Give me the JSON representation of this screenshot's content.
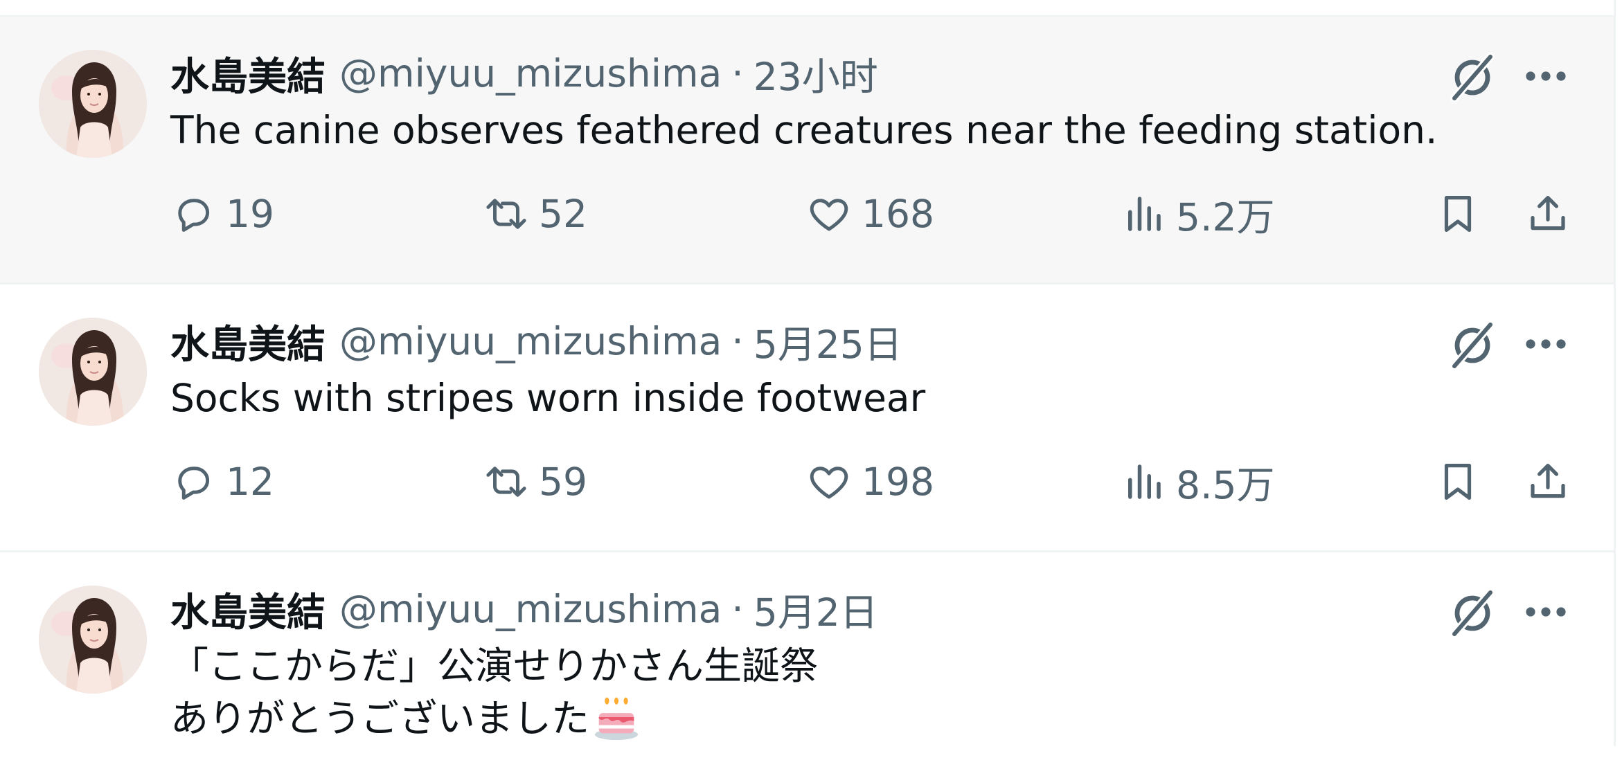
{
  "colors": {
    "text": "#0f1419",
    "muted": "#536471",
    "hover_bg": "#f7f7f7",
    "divider": "#eff3f4"
  },
  "icons": {
    "reply": "speech-bubble-icon",
    "retweet": "retweet-arrows-icon",
    "like": "heart-icon",
    "views": "bar-chart-icon",
    "bookmark": "bookmark-icon",
    "share": "upload-arrow-icon",
    "grok": "grok-slash-circle-icon",
    "more": "three-dots-icon"
  },
  "tweets": [
    {
      "display_name": "水島美結",
      "handle": "@miyuu_mizushima",
      "separator": "·",
      "time": "23小时",
      "text": "The canine observes feathered creatures near the feeding station.",
      "replies": "19",
      "reposts": "52",
      "likes": "168",
      "views": "5.2万"
    },
    {
      "display_name": "水島美結",
      "handle": "@miyuu_mizushima",
      "separator": "·",
      "time": "5月25日",
      "text": "Socks with stripes worn inside footwear",
      "replies": "12",
      "reposts": "59",
      "likes": "198",
      "views": "8.5万"
    },
    {
      "display_name": "水島美結",
      "handle": "@miyuu_mizushima",
      "separator": "·",
      "time": "5月2日",
      "text_line1": "「ここからだ」公演せりかさん生誕祭",
      "text_line2": "ありがとうございました"
    }
  ]
}
